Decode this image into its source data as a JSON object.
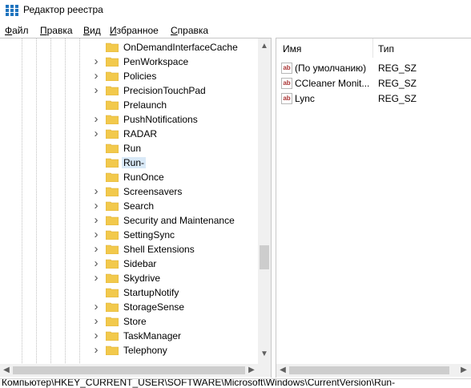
{
  "window": {
    "title": "Редактор реестра"
  },
  "menu": [
    {
      "label": "Файл",
      "hot": "Ф",
      "rest": "айл"
    },
    {
      "label": "Правка",
      "hot": "П",
      "rest": "равка"
    },
    {
      "label": "Вид",
      "hot": "В",
      "rest": "ид"
    },
    {
      "label": "Избранное",
      "hot": "И",
      "rest": "збранное"
    },
    {
      "label": "Справка",
      "hot": "С",
      "rest": "правка"
    }
  ],
  "tree": {
    "items": [
      {
        "label": "OnDemandInterfaceCache",
        "expandable": false
      },
      {
        "label": "PenWorkspace",
        "expandable": true
      },
      {
        "label": "Policies",
        "expandable": true
      },
      {
        "label": "PrecisionTouchPad",
        "expandable": true
      },
      {
        "label": "Prelaunch",
        "expandable": false
      },
      {
        "label": "PushNotifications",
        "expandable": true
      },
      {
        "label": "RADAR",
        "expandable": true
      },
      {
        "label": "Run",
        "expandable": false
      },
      {
        "label": "Run-",
        "expandable": false,
        "selected": true
      },
      {
        "label": "RunOnce",
        "expandable": false
      },
      {
        "label": "Screensavers",
        "expandable": true
      },
      {
        "label": "Search",
        "expandable": true
      },
      {
        "label": "Security and Maintenance",
        "expandable": true
      },
      {
        "label": "SettingSync",
        "expandable": true
      },
      {
        "label": "Shell Extensions",
        "expandable": true
      },
      {
        "label": "Sidebar",
        "expandable": true
      },
      {
        "label": "Skydrive",
        "expandable": true
      },
      {
        "label": "StartupNotify",
        "expandable": false
      },
      {
        "label": "StorageSense",
        "expandable": true
      },
      {
        "label": "Store",
        "expandable": true
      },
      {
        "label": "TaskManager",
        "expandable": true
      },
      {
        "label": "Telephony",
        "expandable": true
      }
    ]
  },
  "values": {
    "columns": {
      "name": "Имя",
      "type": "Тип"
    },
    "rows": [
      {
        "name": "(По умолчанию)",
        "type": "REG_SZ"
      },
      {
        "name": "CCleaner Monit...",
        "type": "REG_SZ"
      },
      {
        "name": "Lync",
        "type": "REG_SZ"
      }
    ]
  },
  "status": {
    "path": "Компьютер\\HKEY_CURRENT_USER\\SOFTWARE\\Microsoft\\Windows\\CurrentVersion\\Run-"
  },
  "colors": {
    "folder": "#f2c94c",
    "selection": "#d9e9f7",
    "title_icon": "#1e73be"
  }
}
